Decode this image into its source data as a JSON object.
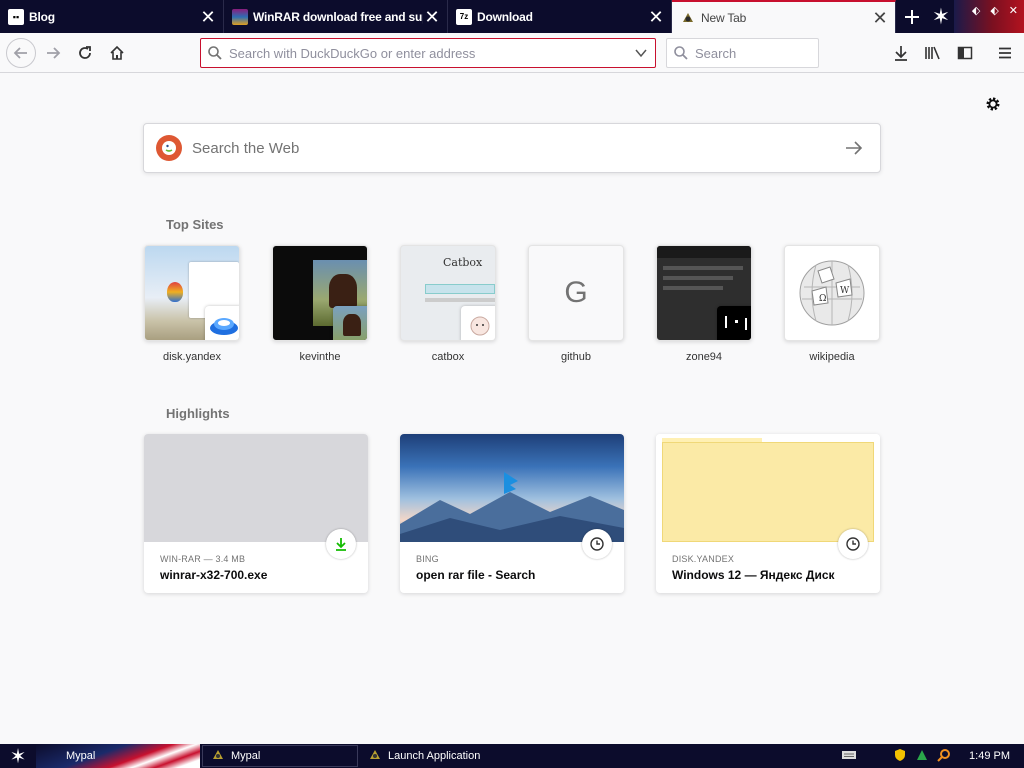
{
  "tabs": [
    {
      "title": "Blog",
      "close": "✕"
    },
    {
      "title": "WinRAR download free and support",
      "close": "✕"
    },
    {
      "title": "Download",
      "close": "✕"
    },
    {
      "title": "New Tab",
      "close": "✕"
    }
  ],
  "toolbar": {
    "url_placeholder": "Search with DuckDuckGo or enter address",
    "search_placeholder": "Search"
  },
  "websearch": {
    "placeholder": "Search the Web"
  },
  "top_sites": {
    "title": "Top Sites",
    "items": [
      {
        "label": "disk.yandex"
      },
      {
        "label": "kevinthe"
      },
      {
        "label": "catbox"
      },
      {
        "label": "github",
        "letter": "G"
      },
      {
        "label": "zone94"
      },
      {
        "label": "wikipedia"
      }
    ]
  },
  "highlights": {
    "title": "Highlights",
    "items": [
      {
        "context": "WIN-RAR — 3.4 MB",
        "title": "winrar-x32-700.exe",
        "badge": "download-icon"
      },
      {
        "context": "BING",
        "title": "open rar file - Search",
        "badge": "clock-icon"
      },
      {
        "context": "DISK.YANDEX",
        "title": "Windows 12 — Яндекс Диск",
        "badge": "clock-icon"
      }
    ]
  },
  "taskbar": {
    "items": [
      "Mypal",
      "Mypal",
      "Launch Application"
    ],
    "clock": "1:49 PM"
  },
  "colors": {
    "accent": "#c8102e",
    "tabstrip": "#0c0c2c",
    "download_green": "#12bc00"
  }
}
